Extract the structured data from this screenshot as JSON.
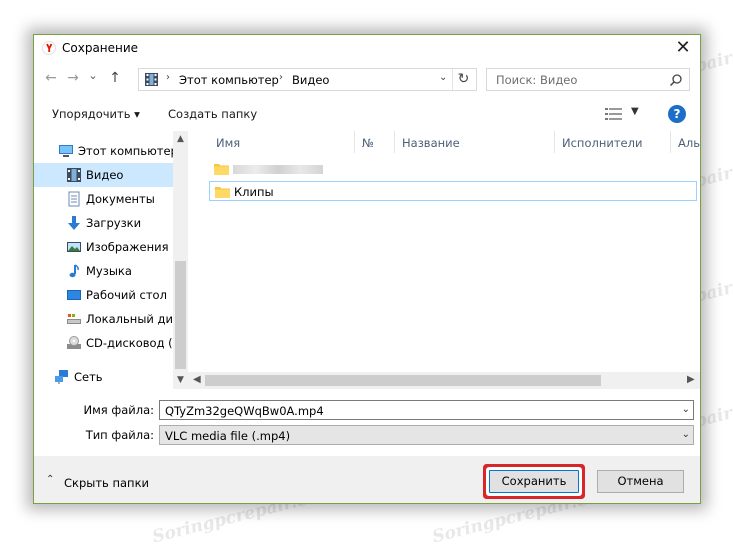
{
  "window": {
    "title": "Сохранение",
    "app_icon": "yandex-browser-icon",
    "close_symbol": "✕"
  },
  "nav": {
    "back_symbol": "←",
    "forward_symbol": "→",
    "history_symbol": "⌄",
    "up_symbol": "↑",
    "breadcrumb": [
      "Этот компьютер",
      "Видео"
    ],
    "crumb_separator": "›",
    "refresh_symbol": "↻",
    "search_placeholder": "Поиск: Видео"
  },
  "toolbar": {
    "organize_label": "Упорядочить ▾",
    "new_folder_label": "Создать папку",
    "help_symbol": "?"
  },
  "sidebar": {
    "items": [
      {
        "label": "Этот компьютер",
        "icon": "computer-icon",
        "selected": false
      },
      {
        "label": "Видео",
        "icon": "video-icon",
        "selected": true
      },
      {
        "label": "Документы",
        "icon": "documents-icon",
        "selected": false
      },
      {
        "label": "Загрузки",
        "icon": "downloads-icon",
        "selected": false
      },
      {
        "label": "Изображения",
        "icon": "pictures-icon",
        "selected": false
      },
      {
        "label": "Музыка",
        "icon": "music-icon",
        "selected": false
      },
      {
        "label": "Рабочий стол",
        "icon": "desktop-icon",
        "selected": false
      },
      {
        "label": "Локальный дис",
        "icon": "local-disk-icon",
        "selected": false
      },
      {
        "label": "CD-дисковод (E",
        "icon": "cd-drive-icon",
        "selected": false
      },
      {
        "label": "Сеть",
        "icon": "network-icon",
        "selected": false
      }
    ]
  },
  "filelist": {
    "columns": [
      "Имя",
      "№",
      "Название",
      "Исполнители",
      "Аль"
    ],
    "rows": [
      {
        "label": "",
        "blurred": true
      },
      {
        "label": "Клипы",
        "blurred": false
      }
    ]
  },
  "form": {
    "filename_label": "Имя файла:",
    "filename_value": "QTyZm32geQWqBw0A.mp4",
    "filetype_label": "Тип файла:",
    "filetype_value": "VLC media file (.mp4)"
  },
  "footer": {
    "hide_folders_label": "Скрыть папки",
    "save_label": "Сохранить",
    "cancel_label": "Отмена"
  },
  "colors": {
    "accent": "#0078d7",
    "highlight_ring": "#d7272b",
    "selection": "#cce8ff",
    "folder": "#f5c842"
  },
  "watermark_text": "Soringpcrepair.com"
}
